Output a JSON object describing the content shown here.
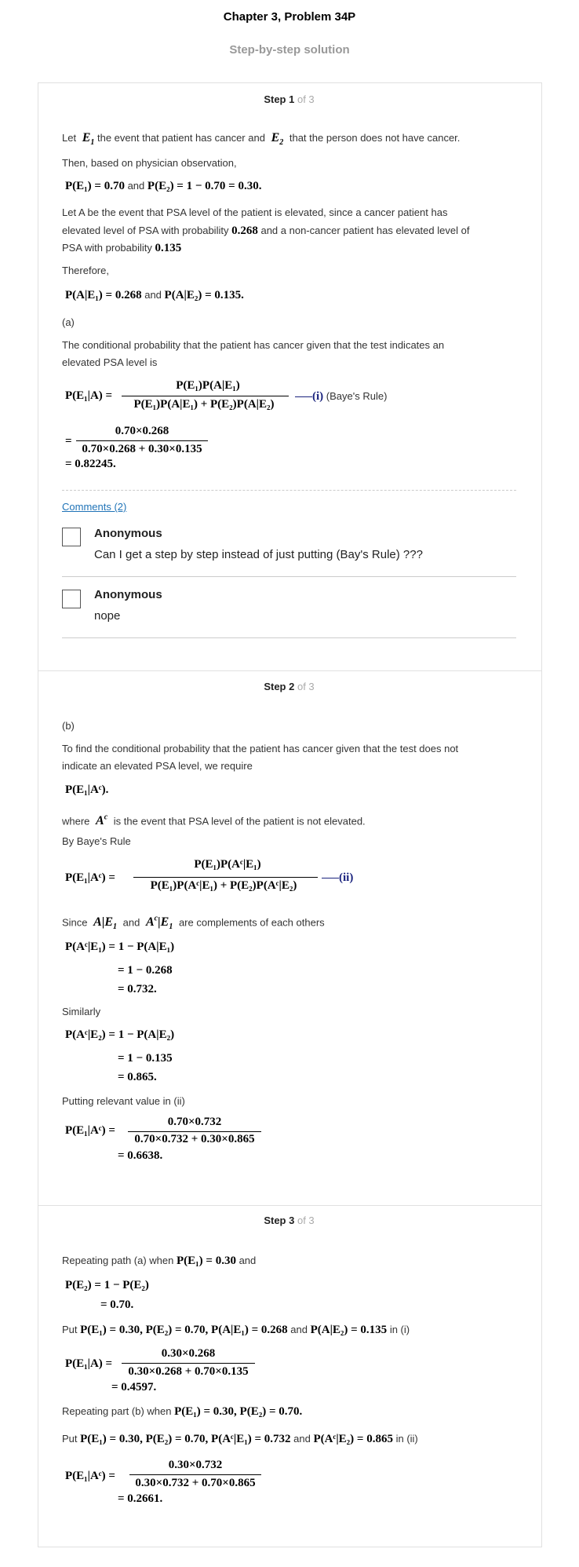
{
  "header": {
    "title": "Chapter 3, Problem 34P",
    "subtitle": "Step-by-step solution"
  },
  "steps": [
    {
      "label": "Step 1",
      "of": "of 3"
    },
    {
      "label": "Step 2",
      "of": "of 3"
    },
    {
      "label": "Step 3",
      "of": "of 3"
    }
  ],
  "step1": {
    "line1_a": "Let",
    "line1_b": "the event that patient has cancer and",
    "line1_c": "that the person does not have cancer.",
    "line2": "Then, based on physician observation,",
    "eq1": "P(E₁) = 0.70",
    "eq1_and": "and",
    "eq1b": "P(E₂) = 1 − 0.70 = 0.30.",
    "para1_l1": "Let A be the event that PSA level of the patient is elevated, since a cancer patient has",
    "para1_l2a": "elevated level of PSA with probability",
    "para1_l2b": "0.268",
    "para1_l2c": "and a non-cancer patient has elevated level of",
    "para1_l3a": "PSA with probability",
    "para1_l3b": "0.135",
    "therefore": "Therefore,",
    "eq2a": "P(A|E₁) = 0.268",
    "eq2_and": "and",
    "eq2b": "P(A|E₂) = 0.135.",
    "part_a": "(a)",
    "para2_l1": "The conditional probability that the patient has cancer given that the test indicates an",
    "para2_l2": "elevated PSA level is",
    "bayes_lhs": "P(E₁|A) =",
    "bayes_num": "P(E₁)P(A|E₁)",
    "bayes_den": "P(E₁)P(A|E₁) + P(E₂)P(A|E₂)",
    "bayes_tag": "(i)",
    "bayes_rule": "(Baye's Rule)",
    "calc_num": "0.70×0.268",
    "calc_den": "0.70×0.268 + 0.30×0.135",
    "calc_res": "= 0.82245."
  },
  "comments": {
    "link": "Comments (2)",
    "items": [
      {
        "author": "Anonymous",
        "text": "Can I get a step by step instead of just putting (Bay's Rule) ???"
      },
      {
        "author": "Anonymous",
        "text": "nope"
      }
    ]
  },
  "step2": {
    "part_b": "(b)",
    "para_l1": "To find the conditional probability that the patient has cancer given that the test does not",
    "para_l2": "indicate an elevated PSA level, we require",
    "req": "P(E₁|Aᶜ).",
    "where_a": "where",
    "where_b": "is the event that PSA level of the patient is not elevated.",
    "by_bayes": "By Baye's Rule",
    "bayes_lhs": "P(E₁|Aᶜ) =",
    "bayes_num": "P(E₁)P(Aᶜ|E₁)",
    "bayes_den": "P(E₁)P(Aᶜ|E₁) + P(E₂)P(Aᶜ|E₂)",
    "bayes_tag": "(ii)",
    "since_a": "Since",
    "since_b": "and",
    "since_c": "are complements of each others",
    "c1_l1": "P(Aᶜ|E₁) = 1 − P(A|E₁)",
    "c1_l2": "= 1 − 0.268",
    "c1_l3": "= 0.732.",
    "similarly": "Similarly",
    "c2_l1": "P(Aᶜ|E₂) = 1 − P(A|E₂)",
    "c2_l2": "= 1 − 0.135",
    "c2_l3": "= 0.865.",
    "putting": "Putting relevant value in (ii)",
    "r_lhs": "P(E₁|Aᶜ) =",
    "r_num": "0.70×0.732",
    "r_den": "0.70×0.732 + 0.30×0.865",
    "r_res": "= 0.6638."
  },
  "step3": {
    "rep_a_1": "Repeating path (a) when",
    "rep_a_eq": "P(E₁) = 0.30",
    "rep_a_2": "and",
    "pe2_l1": "P(E₂) = 1 − P(E₂)",
    "pe2_l2": "= 0.70.",
    "put1_a": "Put",
    "put1_eq": "P(E₁) = 0.30, P(E₂) = 0.70, P(A|E₁) = 0.268",
    "put1_and": "and",
    "put1_eq2": "P(A|E₂) = 0.135",
    "put1_in": "in (i)",
    "r1_lhs": "P(E₁|A) =",
    "r1_num": "0.30×0.268",
    "r1_den": "0.30×0.268 + 0.70×0.135",
    "r1_res": "= 0.4597.",
    "rep_b_1": "Repeating part (b) when",
    "rep_b_eq": "P(E₁) = 0.30, P(E₂) = 0.70.",
    "put2_a": "Put",
    "put2_eq": "P(E₁) = 0.30, P(E₂) = 0.70, P(Aᶜ|E₁) = 0.732",
    "put2_and": "and",
    "put2_eq2": "P(Aᶜ|E₂) = 0.865",
    "put2_in": "in (ii)",
    "r2_lhs": "P(E₁|Aᶜ) =",
    "r2_num": "0.30×0.732",
    "r2_den": "0.30×0.732 + 0.70×0.865",
    "r2_res": "= 0.2661."
  }
}
